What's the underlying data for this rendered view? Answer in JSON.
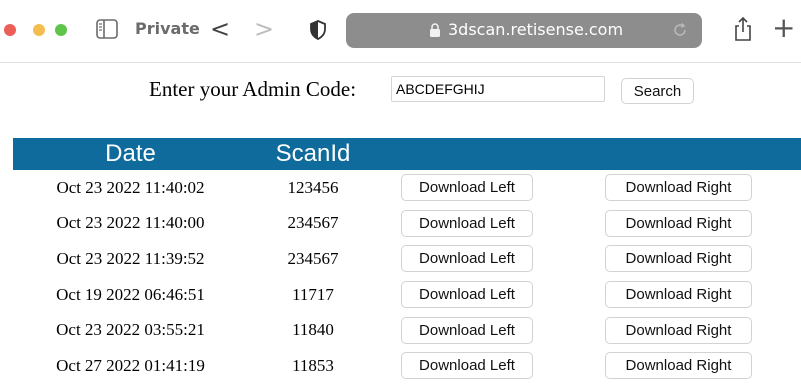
{
  "browser": {
    "private_label": "Private",
    "url": "3dscan.retisense.com",
    "icons": {
      "sidebar": "sidebar-icon",
      "back": "chevron-left-icon",
      "forward": "chevron-right-icon",
      "shield": "shield-icon",
      "lock": "lock-icon",
      "reload": "reload-icon",
      "share": "share-icon",
      "new_tab": "plus-icon"
    },
    "back_glyph": "<",
    "forward_glyph": ">",
    "new_tab_glyph": "+"
  },
  "search": {
    "label": "Enter your Admin Code:",
    "value": "ABCDEFGHIJ",
    "button_label": "Search"
  },
  "table": {
    "headers": {
      "date": "Date",
      "scanid": "ScanId",
      "left": "",
      "right": ""
    },
    "download_left_label": "Download Left",
    "download_right_label": "Download Right",
    "rows": [
      {
        "date": "Oct 23 2022 11:40:02",
        "scanid": "123456"
      },
      {
        "date": "Oct 23 2022 11:40:00",
        "scanid": "234567"
      },
      {
        "date": "Oct 23 2022 11:39:52",
        "scanid": "234567"
      },
      {
        "date": "Oct 19 2022 06:46:51",
        "scanid": "11717"
      },
      {
        "date": "Oct 23 2022 03:55:21",
        "scanid": "11840"
      },
      {
        "date": "Oct 27 2022 01:41:19",
        "scanid": "11853"
      }
    ]
  },
  "colors": {
    "header_bg": "#0e6b9b",
    "address_bar": "#8d8d8d"
  }
}
